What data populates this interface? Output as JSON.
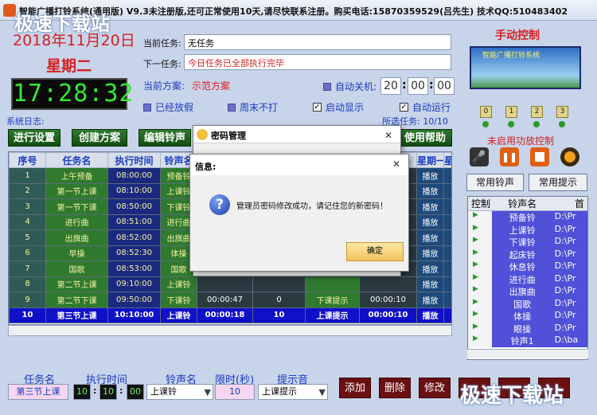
{
  "window": {
    "title": "智能广播打铃系统(通用版) V9.3未注册版,还可正常使用10天,请尽快联系注册。购买电话:15870359529(吕先生) 技术QQ:510483402"
  },
  "watermarks": {
    "top": "极速下载站",
    "bottom": "极速下载站"
  },
  "clock": {
    "date": "2018年11月20日",
    "weekday": "星期二",
    "time": "17:28:32"
  },
  "tasks": {
    "current_label": "当前任务:",
    "current_value": "无任务",
    "next_label": "下一任务:",
    "next_value": "今日任务已全部执行完毕",
    "scheme_label": "当前方案:",
    "scheme_value": "示范方案"
  },
  "auto_shutdown": {
    "label": "自动关机:",
    "h": "20",
    "m": "00",
    "s": "00"
  },
  "options": {
    "holiday": "已经放假",
    "weekend": "周末不打",
    "auto_show": "启动显示",
    "auto_run": "自动运行"
  },
  "log": {
    "label": "系统日志:",
    "selected": "所选任务: 10/10"
  },
  "buttons": {
    "b1": "进行设置",
    "b2": "创建方案",
    "b3": "编辑铃声",
    "b4": "使用帮助"
  },
  "table": {
    "headers": [
      "序号",
      "任务名",
      "执行时间",
      "铃声名",
      "",
      "",
      "",
      "",
      "星期一",
      "星期"
    ],
    "rows": [
      [
        "1",
        "上午预备",
        "08:00:00",
        "预备铃",
        "",
        "",
        "",
        "",
        "播放"
      ],
      [
        "2",
        "第一节上课",
        "08:10:00",
        "上课铃",
        "",
        "",
        "",
        "",
        "播放"
      ],
      [
        "3",
        "第一节下课",
        "08:50:00",
        "下课铃",
        "",
        "",
        "",
        "",
        "播放"
      ],
      [
        "4",
        "进行曲",
        "08:51:00",
        "进行曲",
        "",
        "",
        "",
        "",
        "播放"
      ],
      [
        "5",
        "出旗曲",
        "08:52:00",
        "出旗曲",
        "",
        "",
        "",
        "",
        "播放"
      ],
      [
        "6",
        "早操",
        "08:52:30",
        "体操",
        "",
        "",
        "",
        "",
        "播放"
      ],
      [
        "7",
        "国歌",
        "08:53:00",
        "国歌",
        "",
        "",
        "",
        "",
        "播放"
      ],
      [
        "8",
        "第二节上课",
        "09:10:00",
        "上课铃",
        "",
        "",
        "",
        "",
        "播放"
      ],
      [
        "9",
        "第二节下课",
        "09:50:00",
        "下课铃",
        "00:00:47",
        "0",
        "下课提示",
        "00:00:10",
        "播放"
      ],
      [
        "10",
        "第三节上课",
        "10:10:00",
        "上课铃",
        "00:00:18",
        "10",
        "上课提示",
        "00:00:10",
        "播放"
      ]
    ]
  },
  "right": {
    "title": "手动控制",
    "banner": "智能广播打铃系统",
    "channels": [
      "0",
      "1",
      "2",
      "3"
    ],
    "status": "未启用功放控制",
    "btn_ring": "常用铃声",
    "btn_tip": "常用提示",
    "list_headers": [
      "控制",
      "铃声名",
      "首"
    ],
    "list": [
      [
        "预备铃",
        "D:\\Pr"
      ],
      [
        "上课铃",
        "D:\\Pr"
      ],
      [
        "下课铃",
        "D:\\Pr"
      ],
      [
        "起床铃",
        "D:\\Pr"
      ],
      [
        "休息铃",
        "D:\\Pr"
      ],
      [
        "进行曲",
        "D:\\Pr"
      ],
      [
        "出旗曲",
        "D:\\Pr"
      ],
      [
        "国歌",
        "D:\\Pr"
      ],
      [
        "体操",
        "D:\\Pr"
      ],
      [
        "眼操",
        "D:\\Pr"
      ],
      [
        "铃声1",
        "D:\\ba"
      ]
    ]
  },
  "bottom": {
    "task_label": "任务名",
    "task_value": "第三节上课",
    "time_label": "执行时间",
    "th": "10",
    "tm": "10",
    "ts": "00",
    "ring_label": "铃声名",
    "ring_value": "上课铃",
    "limit_label": "限时(秒)",
    "limit_value": "10",
    "tip_label": "提示音",
    "tip_value": "上课提示",
    "add": "添加",
    "del": "删除",
    "edit": "修改"
  },
  "dialog_pwd": {
    "title": "密码管理"
  },
  "dialog_info": {
    "title": "信息:",
    "message": "管理员密码修改成功，请记住您的新密码！",
    "ok": "确定"
  }
}
